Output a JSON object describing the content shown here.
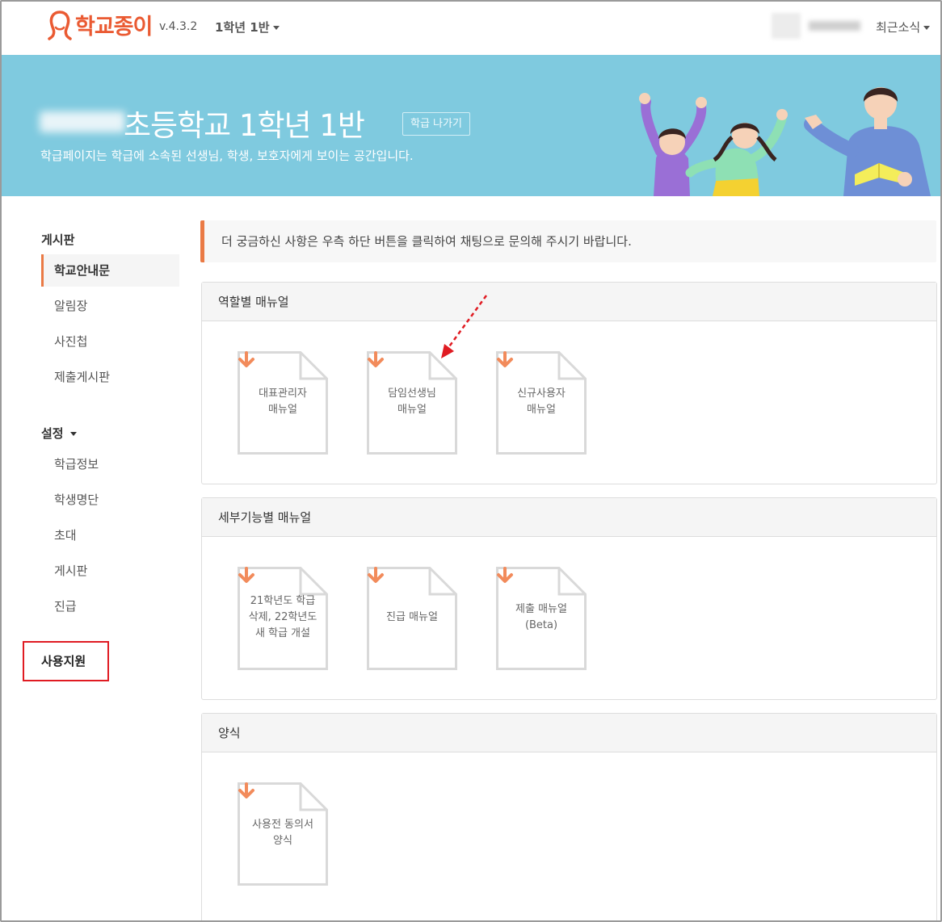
{
  "topnav": {
    "logo_text": "학교종이",
    "version": "v.4.3.2",
    "class_select": "1학년 1반",
    "news": "최근소식"
  },
  "banner": {
    "title": "초등학교 1학년 1반",
    "leave_button": "학급 나가기",
    "subtitle": "학급페이지는 학급에 소속된 선생님, 학생, 보호자에게 보이는 공간입니다."
  },
  "sidebar": {
    "board_heading": "게시판",
    "board_items": [
      {
        "label": "학교안내문"
      },
      {
        "label": "알림장"
      },
      {
        "label": "사진첩"
      },
      {
        "label": "제출게시판"
      }
    ],
    "settings_heading": "설정",
    "settings_items": [
      {
        "label": "학급정보"
      },
      {
        "label": "학생명단"
      },
      {
        "label": "초대"
      },
      {
        "label": "게시판"
      },
      {
        "label": "진급"
      }
    ],
    "support_label": "사용지원"
  },
  "main": {
    "notice": "더 궁금하신 사항은 우측 하단 버튼을 클릭하여 채팅으로 문의해 주시기 바랍니다.",
    "sections": [
      {
        "title": "역할별 매뉴얼",
        "docs": [
          {
            "line1": "대표관리자",
            "line2": "매뉴얼",
            "line3": ""
          },
          {
            "line1": "담임선생님",
            "line2": "매뉴얼",
            "line3": ""
          },
          {
            "line1": "신규사용자",
            "line2": "매뉴얼",
            "line3": ""
          }
        ]
      },
      {
        "title": "세부기능별 매뉴얼",
        "docs": [
          {
            "line1": "21학년도 학급",
            "line2": "삭제, 22학년도",
            "line3": "새 학급 개설"
          },
          {
            "line1": "진급 매뉴얼",
            "line2": "",
            "line3": ""
          },
          {
            "line1": "제출 매뉴얼",
            "line2": "(Beta)",
            "line3": ""
          }
        ]
      },
      {
        "title": "양식",
        "docs": [
          {
            "line1": "사용전 동의서",
            "line2": "양식",
            "line3": ""
          }
        ]
      }
    ]
  },
  "colors": {
    "brand": "#ea5a32",
    "banner_bg": "#7fcadf",
    "accent": "#ea7a45",
    "download_arrow": "#f28b5b",
    "highlight_box": "#e01b22",
    "annotation_arrow": "#e01b22"
  },
  "icons": {
    "logo": "person-silhouette-icon",
    "download": "download-arrow-icon",
    "document": "document-icon"
  }
}
